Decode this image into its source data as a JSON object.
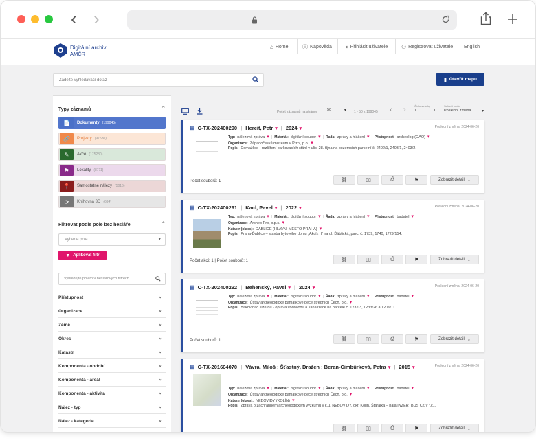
{
  "browser": {
    "back": "‹",
    "forward": "›"
  },
  "header": {
    "logo_line1": "Digitální archiv",
    "logo_line2": "AMČR",
    "nav": [
      "Home",
      "Nápověda",
      "Přihlásit uživatele",
      "Registrovat uživatele",
      "English"
    ]
  },
  "search": {
    "placeholder": "Zadejte vyhledávací dotaz",
    "map_button": "Otevřít mapu"
  },
  "sidebar": {
    "types_title": "Typy záznamů",
    "types": [
      {
        "label": "Dokumenty",
        "count": "(199045)",
        "color": "#4a70c8",
        "bg": "#5276cc",
        "text": "#ffffff",
        "icon": "📄"
      },
      {
        "label": "Projekty",
        "count": "(97580)",
        "color": "#f0894a",
        "bg": "#fce6d6",
        "text": "#e47b3a",
        "icon": "🔗"
      },
      {
        "label": "Akce",
        "count": "(175280)",
        "color": "#2a6a2e",
        "bg": "#d9e8da",
        "text": "#444",
        "icon": "✎"
      },
      {
        "label": "Lokality",
        "count": "(8711)",
        "color": "#8a2a8a",
        "bg": "#ecd9ec",
        "text": "#444",
        "icon": "⚑"
      },
      {
        "label": "Samostatné nálezy",
        "count": "(5016)",
        "color": "#8a1c1c",
        "bg": "#ecd7d7",
        "text": "#444",
        "icon": "📍"
      },
      {
        "label": "Knihovna 3D",
        "count": "(694)",
        "color": "#777777",
        "bg": "#e6e6e6",
        "text": "#666",
        "icon": "⟳"
      }
    ],
    "filter_title": "Filtrovat podle pole bez hesláře",
    "field_placeholder": "Vyberte pole",
    "apply_label": "Aplikovat filtr",
    "filter_search_placeholder": "Vyhledejte pojem v heslářových filtrech",
    "filters": [
      "Přístupnost",
      "Organizace",
      "Země",
      "Okres",
      "Katastr",
      "Komponenta - období",
      "Komponenta - areál",
      "Komponenta - aktivita",
      "Nález - typ",
      "Nález - kategorie"
    ]
  },
  "toolbar": {
    "per_page_label": "Počet záznamů na stránce",
    "per_page": "50",
    "range": "1 - 50 z 199045",
    "page_label": "Číslo stránky",
    "page": "1",
    "sort_label": "Seřadit podle",
    "sort": "Poslední změna"
  },
  "cards": [
    {
      "id": "C-TX-202400290",
      "authors": "Hereit, Petr",
      "year": "2024",
      "date": "Poslední změna: 2024-06-20",
      "l1": [
        [
          "Typ:",
          "nálezová zpráva"
        ],
        [
          "Materiál:",
          "digitální soubor"
        ],
        [
          "Řada:",
          "zprávy a hlášení"
        ],
        [
          "Přístupnost:",
          "archeolog (OAO)"
        ]
      ],
      "org": "Západočeské muzeum v Plzni, p.o.",
      "katastr": "",
      "popis": "Domažlice - rozšíření parkovacích stání v ulici 28. října na pozemcích parcelní č. 2402/1, 2403/1, 2403/2.",
      "footer": "Počet souborů: 1",
      "detail": "Zobrazit detail"
    },
    {
      "id": "C-TX-202400291",
      "authors": "Kacl, Pavel",
      "year": "2022",
      "date": "Poslední změna: 2024-06-20",
      "l1": [
        [
          "Typ:",
          "nálezová zpráva"
        ],
        [
          "Materiál:",
          "digitální soubor"
        ],
        [
          "Řada:",
          "zprávy a hlášení"
        ],
        [
          "Přístupnost:",
          "badatel"
        ]
      ],
      "org": "Archeo Pro, o.p.s.",
      "katastr": "ĎÁBLICE (HLAVNÍ MĚSTO PRAHA)",
      "popis": "Praha-Ďáblice – stavba bytového domu „Akcíz II“ na ul. Ďáblická, parc. č. 1739, 1740, 1729/154.",
      "footer": "Počet akcí: 1 | Počet souborů: 1",
      "detail": "Zobrazit detail"
    },
    {
      "id": "C-TX-202400292",
      "authors": "Behenský, Pavel",
      "year": "2024",
      "date": "Poslední změna: 2024-06-20",
      "l1": [
        [
          "Typ:",
          "nálezová zpráva"
        ],
        [
          "Materiál:",
          "digitální soubor"
        ],
        [
          "Řada:",
          "zprávy a hlášení"
        ],
        [
          "Přístupnost:",
          "badatel"
        ]
      ],
      "org": "Ústav archeologické památkové péče středních Čech, p.o.",
      "katastr": "",
      "popis": "Bakov nad Jizerou - oprava vodovodu a kanalizace na parcele č. 1232/3, 1233/26 a 1206/11.",
      "footer": "Počet souborů: 1",
      "detail": "Zobrazit detail"
    },
    {
      "id": "C-TX-201604070",
      "authors": "Vávra, Miloš ; Šťastný, Dražen ; Beran-Cimbůrková, Petra",
      "year": "2015",
      "date": "Poslední změna: 2024-06-20",
      "l1": [
        [
          "Typ:",
          "nálezová zpráva"
        ],
        [
          "Materiál:",
          "digitální soubor"
        ],
        [
          "Řada:",
          "zprávy a hlášení"
        ],
        [
          "Přístupnost:",
          "badatel"
        ]
      ],
      "org": "Ústav archeologické památkové péče středních Čech, p.o.",
      "katastr": "NEBOVIDY (KOLÍN)",
      "popis": "Zpráva o záchranném archeologickém výzkumu v k.ú. NEBOVIDY, okr. Kolín, Štáralka – hala INZERTBUS CZ v r.c...",
      "footer": "",
      "detail": "Zobrazit detail"
    }
  ],
  "labels": {
    "org": "Organizace:",
    "katastr": "Katastr (okres):",
    "popis": "Popis:"
  }
}
